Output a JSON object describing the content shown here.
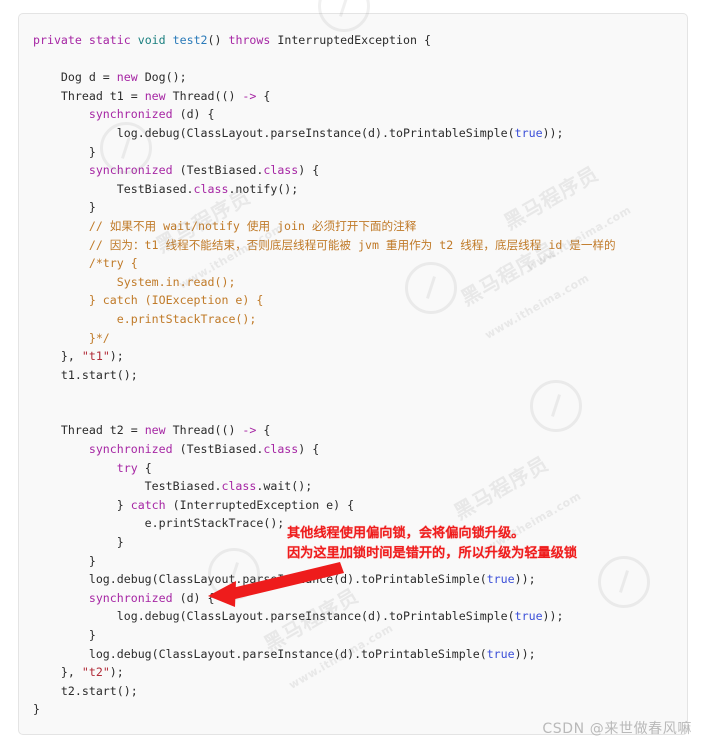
{
  "code": {
    "language": "java",
    "lines": [
      [
        {
          "t": "private ",
          "c": "kw"
        },
        {
          "t": "static ",
          "c": "kw"
        },
        {
          "t": "void ",
          "c": "type"
        },
        {
          "t": "test2",
          "c": "fn"
        },
        {
          "t": "() ",
          "c": "pl"
        },
        {
          "t": "throws ",
          "c": "kw"
        },
        {
          "t": "InterruptedException {",
          "c": "pl"
        }
      ],
      [],
      [
        {
          "t": "    Dog d = ",
          "c": "pl"
        },
        {
          "t": "new ",
          "c": "kw"
        },
        {
          "t": "Dog();",
          "c": "pl"
        }
      ],
      [
        {
          "t": "    Thread t1 = ",
          "c": "pl"
        },
        {
          "t": "new ",
          "c": "kw"
        },
        {
          "t": "Thread(() ",
          "c": "pl"
        },
        {
          "t": "-> ",
          "c": "kw"
        },
        {
          "t": "{",
          "c": "pl"
        }
      ],
      [
        {
          "t": "        ",
          "c": "pl"
        },
        {
          "t": "synchronized ",
          "c": "kw"
        },
        {
          "t": "(d) {",
          "c": "pl"
        }
      ],
      [
        {
          "t": "            log.debug(ClassLayout.parseInstance(d).toPrintableSimple(",
          "c": "pl"
        },
        {
          "t": "true",
          "c": "num"
        },
        {
          "t": "));",
          "c": "pl"
        }
      ],
      [
        {
          "t": "        }",
          "c": "pl"
        }
      ],
      [
        {
          "t": "        ",
          "c": "pl"
        },
        {
          "t": "synchronized ",
          "c": "kw"
        },
        {
          "t": "(TestBiased.",
          "c": "pl"
        },
        {
          "t": "class",
          "c": "kw"
        },
        {
          "t": ") {",
          "c": "pl"
        }
      ],
      [
        {
          "t": "            TestBiased.",
          "c": "pl"
        },
        {
          "t": "class",
          "c": "kw"
        },
        {
          "t": ".notify();",
          "c": "pl"
        }
      ],
      [
        {
          "t": "        }",
          "c": "pl"
        }
      ],
      [
        {
          "t": "        // 如果不用 wait/notify 使用 join 必须打开下面的注释",
          "c": "cmt"
        }
      ],
      [
        {
          "t": "        // 因为：t1 线程不能结束，否则底层线程可能被 jvm 重用作为 t2 线程，底层线程 id 是一样的",
          "c": "cmt"
        }
      ],
      [
        {
          "t": "        /*try {",
          "c": "cmt"
        }
      ],
      [
        {
          "t": "            System.in.read();",
          "c": "cmt"
        }
      ],
      [
        {
          "t": "        } catch (IOException e) {",
          "c": "cmt"
        }
      ],
      [
        {
          "t": "            e.printStackTrace();",
          "c": "cmt"
        }
      ],
      [
        {
          "t": "        }*/",
          "c": "cmt"
        }
      ],
      [
        {
          "t": "    }, ",
          "c": "pl"
        },
        {
          "t": "\"t1\"",
          "c": "str"
        },
        {
          "t": ");",
          "c": "pl"
        }
      ],
      [
        {
          "t": "    t1.start();",
          "c": "pl"
        }
      ],
      [],
      [],
      [
        {
          "t": "    Thread t2 = ",
          "c": "pl"
        },
        {
          "t": "new ",
          "c": "kw"
        },
        {
          "t": "Thread(() ",
          "c": "pl"
        },
        {
          "t": "-> ",
          "c": "kw"
        },
        {
          "t": "{",
          "c": "pl"
        }
      ],
      [
        {
          "t": "        ",
          "c": "pl"
        },
        {
          "t": "synchronized ",
          "c": "kw"
        },
        {
          "t": "(TestBiased.",
          "c": "pl"
        },
        {
          "t": "class",
          "c": "kw"
        },
        {
          "t": ") {",
          "c": "pl"
        }
      ],
      [
        {
          "t": "            ",
          "c": "pl"
        },
        {
          "t": "try ",
          "c": "kw"
        },
        {
          "t": "{",
          "c": "pl"
        }
      ],
      [
        {
          "t": "                TestBiased.",
          "c": "pl"
        },
        {
          "t": "class",
          "c": "kw"
        },
        {
          "t": ".wait();",
          "c": "pl"
        }
      ],
      [
        {
          "t": "            } ",
          "c": "pl"
        },
        {
          "t": "catch ",
          "c": "kw"
        },
        {
          "t": "(InterruptedException e) {",
          "c": "pl"
        }
      ],
      [
        {
          "t": "                e.printStackTrace();",
          "c": "pl"
        }
      ],
      [
        {
          "t": "            }",
          "c": "pl"
        }
      ],
      [
        {
          "t": "        }",
          "c": "pl"
        }
      ],
      [
        {
          "t": "        log.debug(ClassLayout.parseInstance(d).toPrintableSimple(",
          "c": "pl"
        },
        {
          "t": "true",
          "c": "num"
        },
        {
          "t": "));",
          "c": "pl"
        }
      ],
      [
        {
          "t": "        ",
          "c": "pl"
        },
        {
          "t": "synchronized ",
          "c": "kw"
        },
        {
          "t": "(d) {",
          "c": "pl"
        }
      ],
      [
        {
          "t": "            log.debug(ClassLayout.parseInstance(d).toPrintableSimple(",
          "c": "pl"
        },
        {
          "t": "true",
          "c": "num"
        },
        {
          "t": "));",
          "c": "pl"
        }
      ],
      [
        {
          "t": "        }",
          "c": "pl"
        }
      ],
      [
        {
          "t": "        log.debug(ClassLayout.parseInstance(d).toPrintableSimple(",
          "c": "pl"
        },
        {
          "t": "true",
          "c": "num"
        },
        {
          "t": "));",
          "c": "pl"
        }
      ],
      [
        {
          "t": "    }, ",
          "c": "pl"
        },
        {
          "t": "\"t2\"",
          "c": "str"
        },
        {
          "t": ");",
          "c": "pl"
        }
      ],
      [
        {
          "t": "    t2.start();",
          "c": "pl"
        }
      ],
      [
        {
          "t": "}",
          "c": "pl"
        }
      ]
    ]
  },
  "annotation": {
    "line1": "其他线程使用偏向锁，会将偏向锁升级。",
    "line2": "因为这里加锁时间是错开的，所以升级为轻量级锁",
    "color": "#ef1c1c",
    "arrow_target_label": "synchronized (d) {"
  },
  "watermarks": {
    "brand_cn": "黑马程序员",
    "brand_url": "www.itheima.com",
    "csdn": "CSDN @来世做春风嘛"
  },
  "colors": {
    "card_background": "#f9f9f9",
    "card_border": "#e4e4e4",
    "keyword": "#a626a4",
    "type": "#1a7f7f",
    "function": "#2a7ab9",
    "literal": "#3b4fd8",
    "string": "#b02a37",
    "comment": "#c07a28",
    "plain": "#2b2b2b",
    "annotation_red": "#ef1c1c",
    "csdn_gray": "#b9b9b9"
  }
}
